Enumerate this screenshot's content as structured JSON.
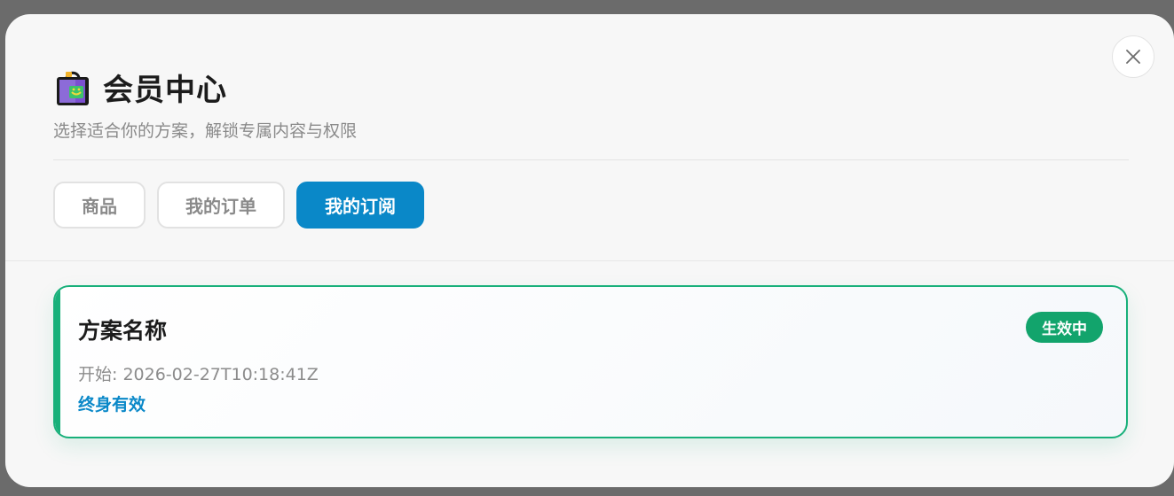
{
  "header": {
    "icon": "shopping-bag-icon",
    "title": "会员中心",
    "subtitle": "选择适合你的方案，解锁专属内容与权限"
  },
  "close": {
    "icon": "close-icon"
  },
  "tabs": [
    {
      "label": "商品",
      "active": false
    },
    {
      "label": "我的订单",
      "active": false
    },
    {
      "label": "我的订阅",
      "active": true
    }
  ],
  "subscription": {
    "plan_name": "方案名称",
    "status": "生效中",
    "start_label": "开始:",
    "start_value": "2026-02-27T10:18:41Z",
    "duration": "终身有效"
  },
  "colors": {
    "accent": "#0a88c8",
    "active_green": "#18b07a",
    "badge_green": "#12a46c"
  }
}
